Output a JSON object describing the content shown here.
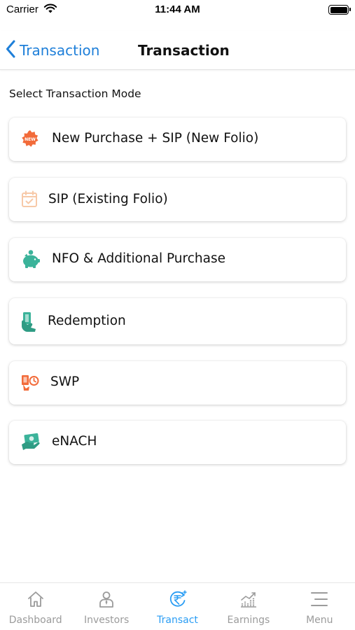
{
  "status_bar": {
    "carrier": "Carrier",
    "time": "11:44 AM"
  },
  "nav": {
    "back_label": "Transaction",
    "title": "Transaction"
  },
  "section_label": "Select Transaction Mode",
  "options": [
    {
      "label": "New Purchase + SIP (New Folio)",
      "icon": "new-badge-icon",
      "color": "#f26b3a"
    },
    {
      "label": "SIP (Existing Folio)",
      "icon": "calendar-check-icon",
      "color": "#f7c9a8"
    },
    {
      "label": "NFO & Additional Purchase",
      "icon": "piggy-bank-icon",
      "color": "#3bb39a"
    },
    {
      "label": "Redemption",
      "icon": "hand-money-icon",
      "color": "#3bb39a"
    },
    {
      "label": "SWP",
      "icon": "withdrawal-icon",
      "color": "#f26b3a"
    },
    {
      "label": "eNACH",
      "icon": "mandate-cash-icon",
      "color": "#3bb39a"
    }
  ],
  "tabs": [
    {
      "label": "Dashboard",
      "icon": "home-icon",
      "active": false
    },
    {
      "label": "Investors",
      "icon": "investor-icon",
      "active": false
    },
    {
      "label": "Transact",
      "icon": "rupee-transact-icon",
      "active": true
    },
    {
      "label": "Earnings",
      "icon": "chart-icon",
      "active": false
    },
    {
      "label": "Menu",
      "icon": "menu-icon",
      "active": false
    }
  ],
  "colors": {
    "accent": "#1e7fd9",
    "tab_active": "#2a9df4",
    "tab_inactive": "#9b9b9b"
  }
}
